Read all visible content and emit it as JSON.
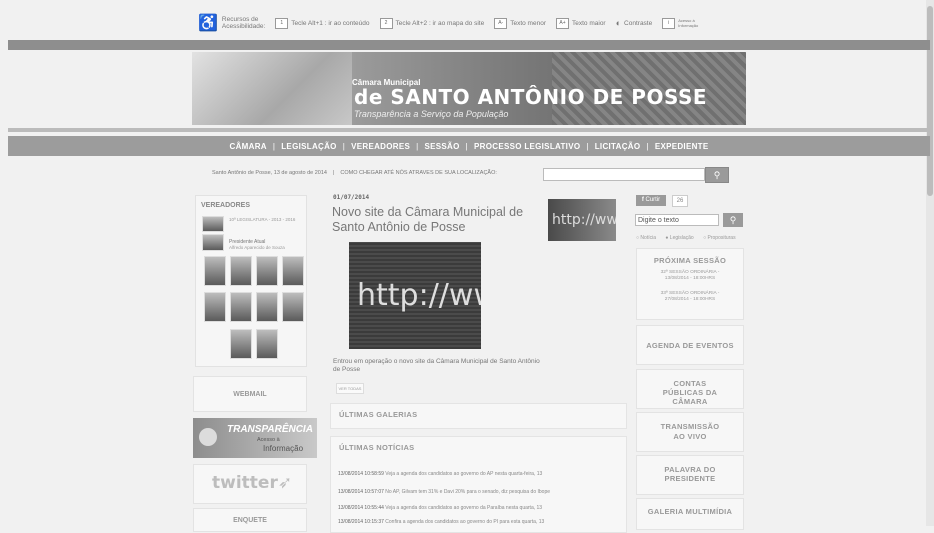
{
  "accessibility": {
    "title_line1": "Recursos de",
    "title_line2": "Acessibilidade:",
    "items": [
      {
        "icon": "1",
        "label": "Tecle Alt+1 : ir ao conteúdo"
      },
      {
        "icon": "2",
        "label": "Tecle Alt+2 : ir ao mapa do site"
      },
      {
        "icon": "A-",
        "label": "Texto menor"
      },
      {
        "icon": "A+",
        "label": "Texto maior"
      },
      {
        "icon": "◐",
        "label": "Contraste"
      },
      {
        "icon": "i",
        "label": "Acesso à Informação"
      }
    ]
  },
  "banner": {
    "line1": "Câmara Municipal",
    "line2": "de SANTO ANTÔNIO DE POSSE",
    "line3": "Transparência a Serviço da População"
  },
  "nav": [
    "CÂMARA",
    "LEGISLAÇÃO",
    "VEREADORES",
    "SESSÃO",
    "PROCESSO LEGISLATIVO",
    "LICITAÇÃO",
    "EXPEDIENTE"
  ],
  "topbar": {
    "date": "Santo Antônio de Posse, 13 de agosto de 2014",
    "location_prompt": "COMO CHEGAR ATÉ NÓS ATRAVES DE SUA LOCALIZAÇÃO:",
    "search_icon": "search-icon"
  },
  "vereadores": {
    "title": "VEREADORES",
    "legislatura": "10ª LEGISLATURA - 2013 - 2016",
    "presidente_label": "Presidente Atual",
    "presidente_name": "Alfredo Aparecido de Souza"
  },
  "left_boxes": {
    "webmail": "WEBMAIL",
    "transp_title": "TRANSPARÊNCIA",
    "transp_sub": "Acesso à",
    "transp_sub2": "Informação",
    "twitter": "twitter",
    "enquete": "ENQUETE"
  },
  "article": {
    "date": "01/07/2014",
    "title": "Novo site da Câmara Municipal de Santo Antônio de Posse",
    "image_text": "http://www",
    "thumb_text": "http://www",
    "intro": "Entrou em operação o novo site da Câmara Municipal de Santo Antônio de Posse",
    "ver_todas": "VER TODAS"
  },
  "galerias": {
    "title": "ÚLTIMAS GALERIAS"
  },
  "noticias": {
    "title": "ÚLTIMAS NOTÍCIAS",
    "items": [
      {
        "time": "13/08/2014 10:58:59",
        "text": "Veja a agenda dos candidatos ao governo do AP nesta quarta-feira, 13"
      },
      {
        "time": "13/08/2014 10:57:07",
        "text": "No AP, Gilvam tem 31% e Davi 20% para o senado, diz pesquisa do Ibope"
      },
      {
        "time": "13/08/2014 10:55:44",
        "text": "Veja a agenda dos candidatos ao governo da Paraíba nesta quarta, 13"
      },
      {
        "time": "13/08/2014 10:15:37",
        "text": "Confira a agenda dos candidatos ao governo do PI para esta quarta, 13"
      }
    ]
  },
  "right": {
    "curtir": "Curtir",
    "curtir_count": "26",
    "search_placeholder": "Digite o texto",
    "radios": [
      "Notícia",
      "Legislação",
      "Proposituras"
    ],
    "proxima_sessao": {
      "title": "PRÓXIMA SESSÃO",
      "items": [
        "32ª SESSÃO ORDINÁRIA - 13/08/2014 - 18:00HRS",
        "33ª SESSÃO ORDINÁRIA - 27/08/2014 - 18:00HRS"
      ]
    },
    "boxes": [
      "AGENDA DE EVENTOS",
      "CONTAS PÚBLICAS DA CÂMARA",
      "TRANSMISSÃO AO VIVO",
      "PALAVRA DO PRESIDENTE",
      "GALERIA MULTIMÍDIA"
    ]
  }
}
